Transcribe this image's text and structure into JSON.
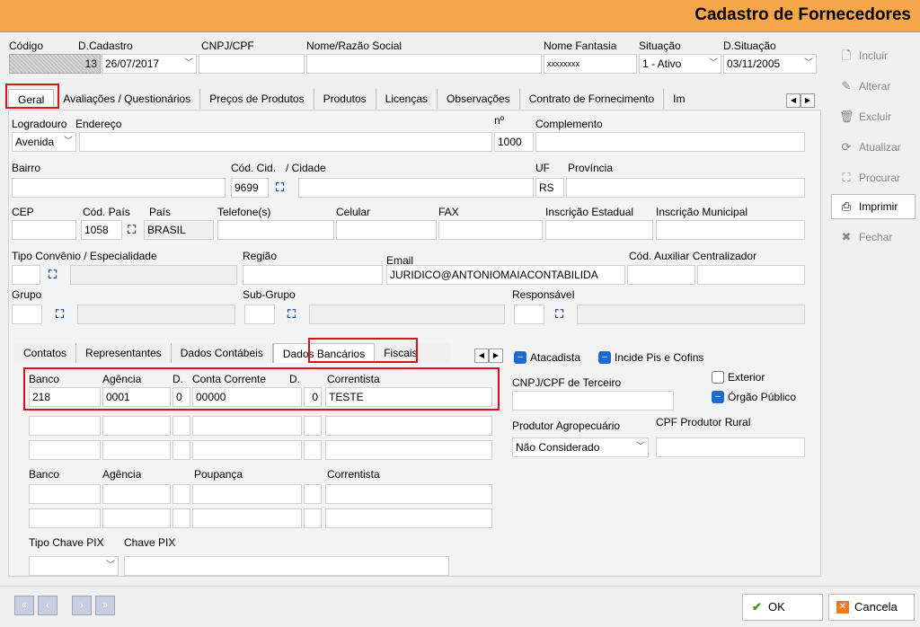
{
  "window": {
    "title": "Cadastro de Fornecedores"
  },
  "header": {
    "codigo_label": "Código",
    "codigo_value": "13",
    "dcadastro_label": "D.Cadastro",
    "dcadastro_value": "26/07/2017",
    "cnpj_label": "CNPJ/CPF",
    "cnpj_value": "",
    "nome_label": "Nome/Razão Social",
    "nome_value": "",
    "fantasia_label": "Nome Fantasia",
    "fantasia_value": "xxxxxxxx",
    "situacao_label": "Situação",
    "situacao_value": "1 - Ativo",
    "dsituacao_label": "D.Situação",
    "dsituacao_value": "03/11/2005"
  },
  "tabs": [
    "Geral",
    "Avaliações / Questionários",
    "Preços de Produtos",
    "Produtos",
    "Licenças",
    "Observações",
    "Contrato de Fornecimento",
    "Im"
  ],
  "geral": {
    "logradouro_label": "Logradouro",
    "logradouro_value": "Avenida",
    "endereco_label": "Endereço",
    "endereco_value": "",
    "numero_label": "nº",
    "numero_value": "1000",
    "complemento_label": "Complemento",
    "complemento_value": "",
    "bairro_label": "Bairro",
    "bairro_value": "",
    "codcid_label": "Cód. Cid.",
    "codcid_value": "9699",
    "cidade_label": "/ Cidade",
    "cidade_value": "",
    "uf_label": "UF",
    "uf_value": "RS",
    "provincia_label": "Província",
    "provincia_value": "",
    "cep_label": "CEP",
    "cep_value": "",
    "codpais_label": "Cód. País",
    "codpais_value": "1058",
    "pais_label": "País",
    "pais_value": "BRASIL",
    "telefone_label": "Telefone(s)",
    "celular_label": "Celular",
    "fax_label": "FAX",
    "ie_label": "Inscrição Estadual",
    "im_label": "Inscrição Municipal",
    "convenio_label": "Tipo Convênio / Especialidade",
    "regiao_label": "Região",
    "email_label": "Email",
    "email_value": "JURIDICO@ANTONIOMAIACONTABILIDA",
    "codaux_label": "Cód. Auxiliar Centralizador",
    "grupo_label": "Grupo",
    "subgrupo_label": "Sub-Grupo",
    "responsavel_label": "Responsável"
  },
  "subtabs": [
    "Contatos",
    "Representantes",
    "Dados Contábeis",
    "Dados Bancários",
    "Fiscais"
  ],
  "bancarios": {
    "banco_label": "Banco",
    "agencia_label": "Agência",
    "d_label": "D.",
    "conta_label": "Conta Corrente",
    "correntista_label": "Correntista",
    "row1": {
      "banco": "218",
      "agencia": "0001",
      "d1": "0",
      "conta": "00000",
      "d2": "0",
      "correntista": "TESTE"
    },
    "poupanca_label": "Poupança",
    "pix_tipo_label": "Tipo Chave PIX",
    "pix_label": "Chave PIX"
  },
  "right_opts": {
    "atacadista": "Atacadista",
    "incide": "Incide Pis e Cofins",
    "cnpj_terceiro": "CNPJ/CPF de Terceiro",
    "exterior": "Exterior",
    "orgao": "Órgão Público",
    "produtor_label": "Produtor Agropecuário",
    "produtor_value": "Não Considerado",
    "cpf_rural": "CPF Produtor Rural"
  },
  "sidebar": [
    "Incluir",
    "Alterar",
    "Excluir",
    "Atualizar",
    "Procurar",
    "Imprimir",
    "Fechar"
  ],
  "footer": {
    "ok": "OK",
    "cancela": "Cancela"
  }
}
